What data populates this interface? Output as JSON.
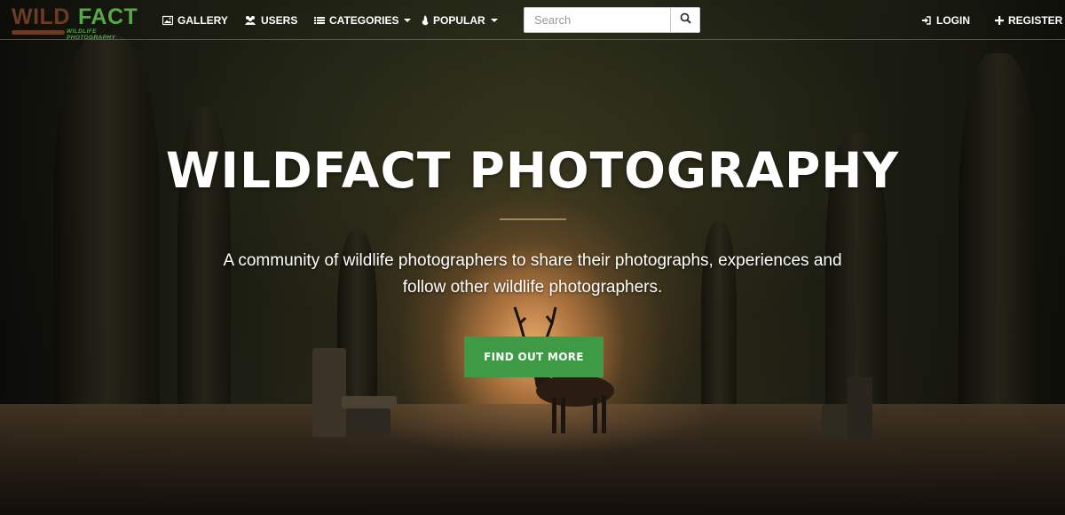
{
  "brand": {
    "name_part1": "WILD",
    "name_part2": "FACT",
    "tagline": "WILDLIFE PHOTOGRAPHY",
    "color_primary": "#6b3b23",
    "color_accent": "#58a84a"
  },
  "nav": {
    "items": [
      {
        "label": "GALLERY",
        "icon": "image-icon"
      },
      {
        "label": "USERS",
        "icon": "users-icon"
      },
      {
        "label": "CATEGORIES",
        "icon": "list-icon",
        "dropdown": true
      },
      {
        "label": "POPULAR",
        "icon": "fire-icon",
        "dropdown": true
      }
    ],
    "search_placeholder": "Search",
    "search_icon": "search-icon",
    "right": [
      {
        "label": "LOGIN",
        "icon": "sign-in-icon"
      },
      {
        "label": "REGISTER",
        "icon": "plus-icon"
      }
    ]
  },
  "hero": {
    "title": "WILDFACT PHOTOGRAPHY",
    "subtitle": "A community of wildlife photographers to share their photographs, experiences and follow other wildlife photographers.",
    "cta_label": "FIND OUT MORE",
    "cta_color": "#3e9a44"
  }
}
